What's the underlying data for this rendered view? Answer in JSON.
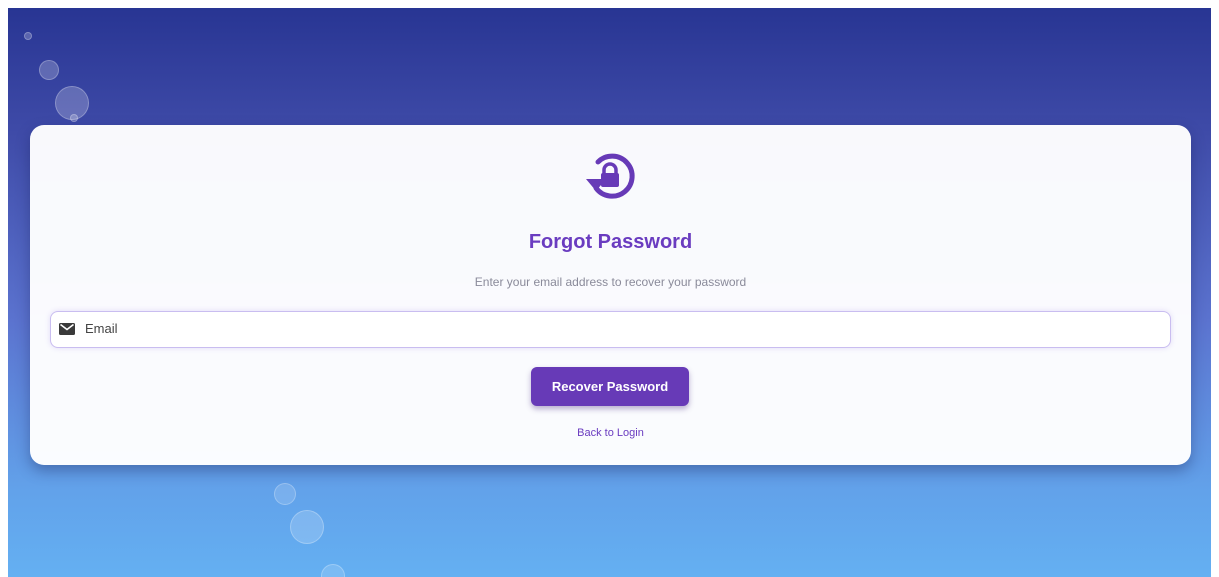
{
  "theme": {
    "accent": "#673ab7",
    "title_color": "#6a3cc0",
    "gradient_top": "#283593",
    "gradient_bottom": "#64b0f2"
  },
  "icons": {
    "header": "lock-reset-icon",
    "email": "mail-icon"
  },
  "card": {
    "title": "Forgot Password",
    "subtitle": "Enter your email address to recover your password"
  },
  "form": {
    "email": {
      "placeholder": "Email",
      "value": ""
    },
    "submit_label": "Recover Password",
    "back_link_label": "Back to Login"
  }
}
